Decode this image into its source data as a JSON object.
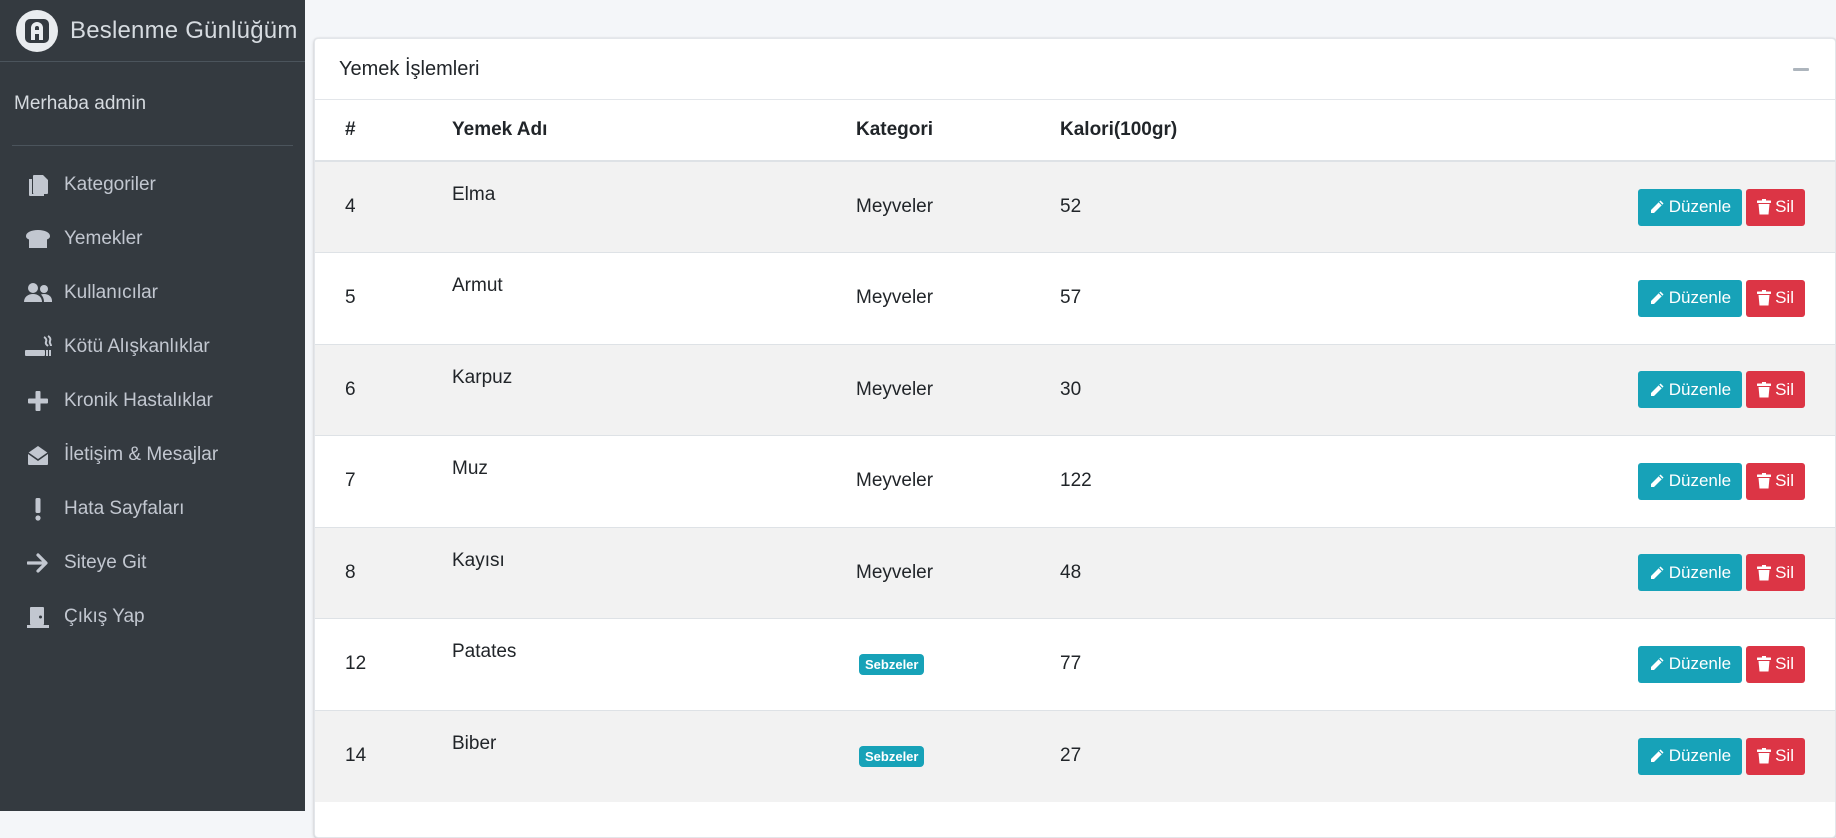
{
  "brand": {
    "title": "Beslenme Günlüğüm"
  },
  "user": {
    "greeting": "Merhaba admin"
  },
  "sidebar": {
    "items": [
      {
        "label": "Kategoriler",
        "icon": "copy-icon"
      },
      {
        "label": "Yemekler",
        "icon": "bread-icon"
      },
      {
        "label": "Kullanıcılar",
        "icon": "users-icon"
      },
      {
        "label": "Kötü Alışkanlıklar",
        "icon": "smoking-icon"
      },
      {
        "label": "Kronik Hastalıklar",
        "icon": "plus-icon"
      },
      {
        "label": "İletişim & Mesajlar",
        "icon": "envelope-open-icon"
      },
      {
        "label": "Hata Sayfaları",
        "icon": "exclamation-icon"
      },
      {
        "label": "Siteye Git",
        "icon": "arrow-right-icon"
      },
      {
        "label": "Çıkış Yap",
        "icon": "door-icon"
      }
    ]
  },
  "card": {
    "title": "Yemek İşlemleri"
  },
  "table": {
    "headers": {
      "id": "#",
      "name": "Yemek Adı",
      "category": "Kategori",
      "calorie": "Kalori(100gr)"
    },
    "edit_label": "Düzenle",
    "delete_label": "Sil",
    "rows": [
      {
        "id": "4",
        "name": "Elma",
        "category": "Meyveler",
        "category_badge": false,
        "calorie": "52"
      },
      {
        "id": "5",
        "name": "Armut",
        "category": "Meyveler",
        "category_badge": false,
        "calorie": "57"
      },
      {
        "id": "6",
        "name": "Karpuz",
        "category": "Meyveler",
        "category_badge": false,
        "calorie": "30"
      },
      {
        "id": "7",
        "name": "Muz",
        "category": "Meyveler",
        "category_badge": false,
        "calorie": "122"
      },
      {
        "id": "8",
        "name": "Kayısı",
        "category": "Meyveler",
        "category_badge": false,
        "calorie": "48"
      },
      {
        "id": "12",
        "name": "Patates",
        "category": "Sebzeler",
        "category_badge": true,
        "calorie": "77"
      },
      {
        "id": "14",
        "name": "Biber",
        "category": "Sebzeler",
        "category_badge": true,
        "calorie": "27"
      }
    ]
  },
  "colors": {
    "sidebar_bg": "#343a40",
    "info": "#17a2b8",
    "danger": "#dc3545"
  }
}
